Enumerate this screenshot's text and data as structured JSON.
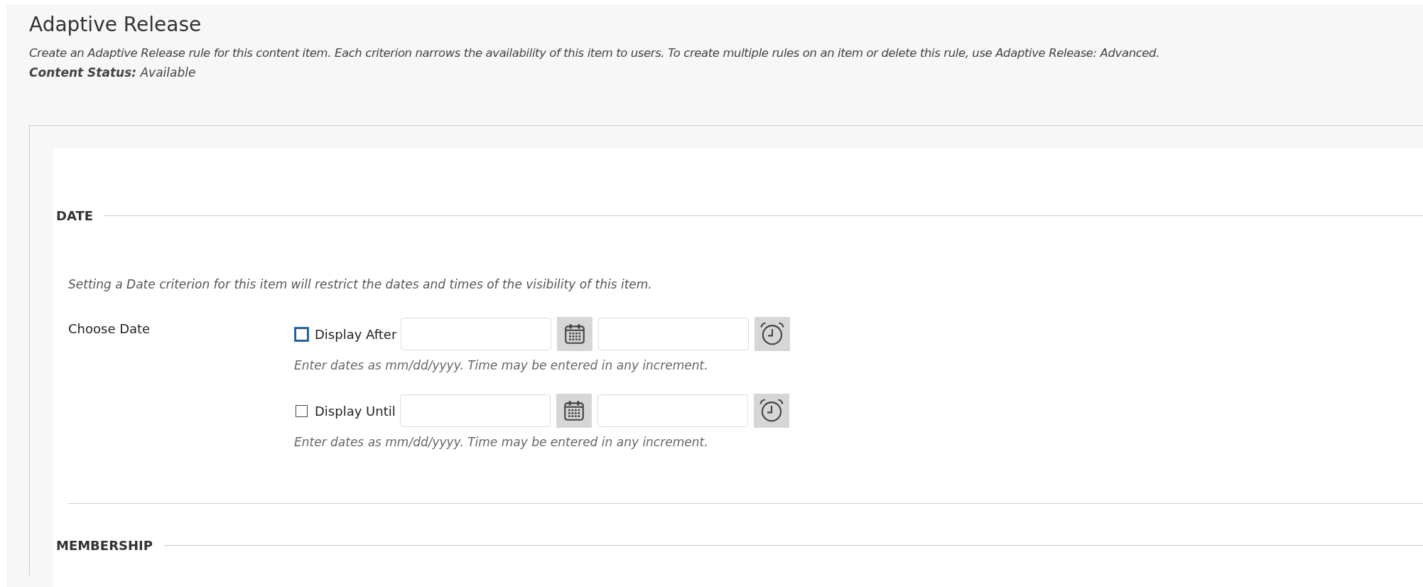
{
  "page": {
    "title": "Adaptive Release",
    "description": "Create an Adaptive Release rule for this content item. Each criterion narrows the availability of this item to users. To create multiple rules on an item or delete this rule, use Adaptive Release: Advanced.",
    "status": "**Content Status:** Available"
  },
  "sections": [
    {
      "heading": "DATE",
      "instructions": "Setting a Date criterion for this item will restrict the dates and times of the visibility of this item.",
      "field_label": "Choose Date",
      "options": [
        {
          "label": "Display After",
          "checked": false,
          "focused": true,
          "hint": "Enter dates as mm/dd/yyyy. Time may be entered in any increment."
        },
        {
          "label": "Display Until",
          "checked": false,
          "focused": false,
          "hint": "Enter dates as mm/dd/yyyy. Time may be entered in any increment."
        }
      ]
    },
    {
      "heading": "MEMBERSHIP"
    }
  ]
}
